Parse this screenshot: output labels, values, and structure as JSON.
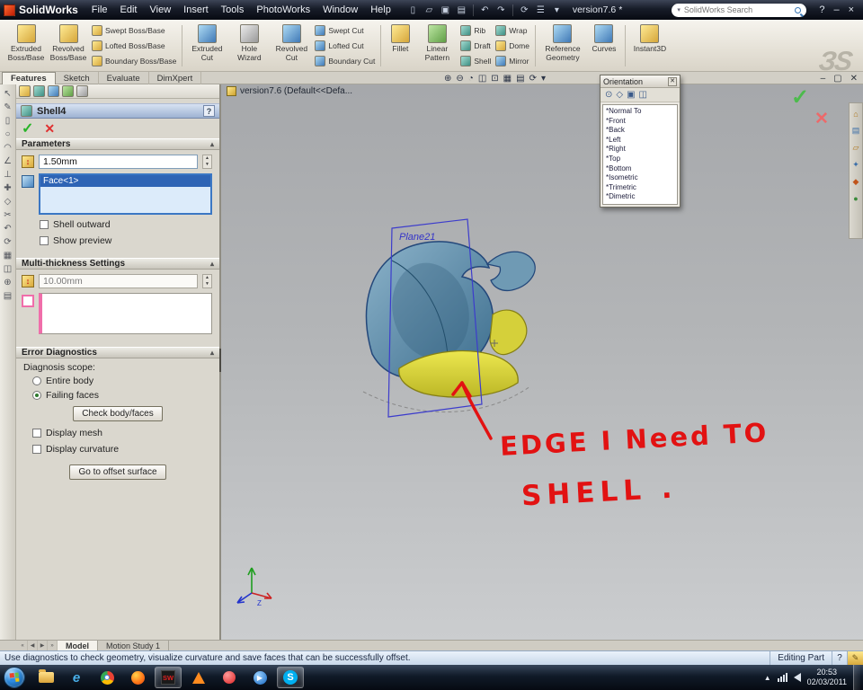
{
  "titlebar": {
    "app_name": "SolidWorks",
    "menus": [
      "File",
      "Edit",
      "View",
      "Insert",
      "Tools",
      "PhotoWorks",
      "Window",
      "Help"
    ],
    "version_text": "version7.6 *",
    "search_placeholder": "SolidWorks Search",
    "help_label": "?",
    "minimize_label": "–",
    "close_label": "×"
  },
  "ribbon": {
    "boss_big": [
      "Extruded Boss/Base",
      "Revolved Boss/Base"
    ],
    "boss_small": [
      "Swept Boss/Base",
      "Lofted Boss/Base",
      "Boundary Boss/Base"
    ],
    "cut_big": [
      "Extruded Cut",
      "Hole Wizard",
      "Revolved Cut"
    ],
    "cut_small": [
      "Swept Cut",
      "Lofted Cut",
      "Boundary Cut"
    ],
    "feature_big": [
      "Fillet",
      "Linear Pattern"
    ],
    "feature_small_a": [
      "Rib",
      "Draft",
      "Shell"
    ],
    "feature_small_b": [
      "Wrap",
      "Dome",
      "Mirror"
    ],
    "ref_big": [
      "Reference Geometry",
      "Curves"
    ],
    "instant": "Instant3D",
    "watermark": "ЗS"
  },
  "command_tabs": {
    "items": [
      "Features",
      "Sketch",
      "Evaluate",
      "DimXpert"
    ]
  },
  "property_manager": {
    "title": "Shell4",
    "help": "?",
    "parameters": {
      "header": "Parameters",
      "thickness": "1.50mm",
      "face": "Face<1>",
      "shell_outward": "Shell outward",
      "show_preview": "Show preview"
    },
    "multi": {
      "header": "Multi-thickness Settings",
      "value": "10.00mm"
    },
    "diag": {
      "header": "Error Diagnostics",
      "scope": "Diagnosis scope:",
      "entire": "Entire body",
      "failing": "Failing faces",
      "check_btn": "Check body/faces",
      "mesh": "Display mesh",
      "curvature": "Display curvature",
      "offset_btn": "Go to offset surface"
    }
  },
  "viewport": {
    "tree_item": "version7.6 (Default<<Defa...",
    "plane_label": "Plane21",
    "annotation": {
      "line1": "EDGE I Need TO",
      "line2": "SHELL ."
    },
    "orientation": {
      "title": "Orientation",
      "items": [
        "*Normal To",
        "*Front",
        "*Back",
        "*Left",
        "*Right",
        "*Top",
        "*Bottom",
        "*Isometric",
        "*Trimetric",
        "*Dimetric"
      ]
    }
  },
  "bottom": {
    "tabs": [
      "Model",
      "Motion Study 1"
    ],
    "status": "Use diagnostics to check geometry, visualize curvature and save faces that can be successfully offset.",
    "editing": "Editing Part",
    "help": "?"
  },
  "taskbar": {
    "time": "20:53",
    "date": "02/03/2011",
    "sw_label": "SW",
    "skype_label": "S",
    "ie_label": "e"
  }
}
